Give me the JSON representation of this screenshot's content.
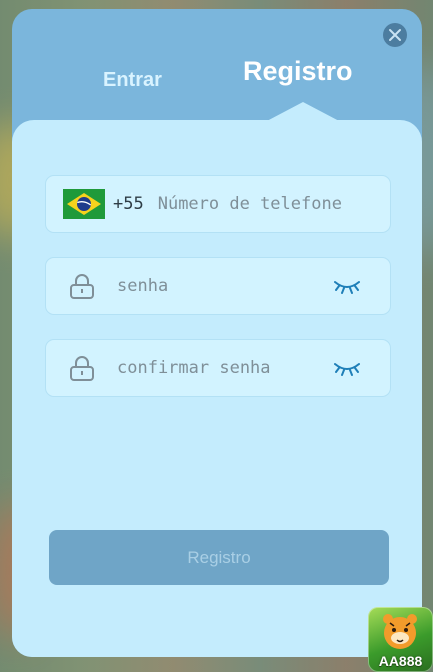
{
  "tabs": {
    "login_label": "Entrar",
    "register_label": "Registro"
  },
  "phone_field": {
    "flag_icon": "brazil-flag-icon",
    "dial_code": "+55",
    "placeholder": "Número de telefone"
  },
  "password_field": {
    "placeholder": "senha",
    "icon": "lock-icon",
    "toggle_icon": "eye-closed-icon"
  },
  "confirm_password_field": {
    "placeholder": "confirmar senha",
    "icon": "lock-icon",
    "toggle_icon": "eye-closed-icon"
  },
  "submit": {
    "label": "Registro"
  },
  "brand": {
    "logo_text": "AA888"
  },
  "colors": {
    "accent": "#7bb6dc",
    "panel": "#c4ecfd",
    "button": "#6fa5c7",
    "eye_icon": "#1f7fb8"
  }
}
